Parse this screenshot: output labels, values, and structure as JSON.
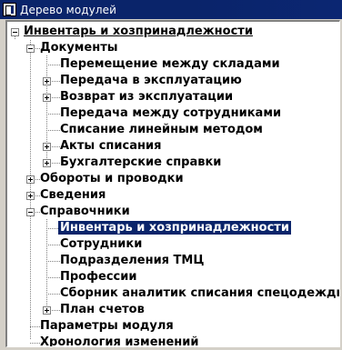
{
  "window": {
    "title": "Дерево модулей",
    "icon": "app-icon"
  },
  "tree": {
    "root": "Инвентарь и хозпринадлежности",
    "documents": "Документы",
    "doc_items": [
      "Перемещение между складами",
      "Передача в эксплуатацию",
      "Возврат из эксплуатации",
      "Передача между сотрудниками",
      "Списание линейным методом",
      "Акты списания",
      "Бухгалтерские справки"
    ],
    "turnovers": "Обороты и проводки",
    "info": "Сведения",
    "references": "Справочники",
    "ref_items": [
      "Инвентарь и хозпринадлежности",
      "Сотрудники",
      "Подразделения ТМЦ",
      "Профессии",
      "Сборник аналитик списания спецодежды",
      "План счетов"
    ],
    "module_params": "Параметры модуля",
    "history": "Хронология изменений",
    "selected": "Инвентарь и хозпринадлежности"
  }
}
